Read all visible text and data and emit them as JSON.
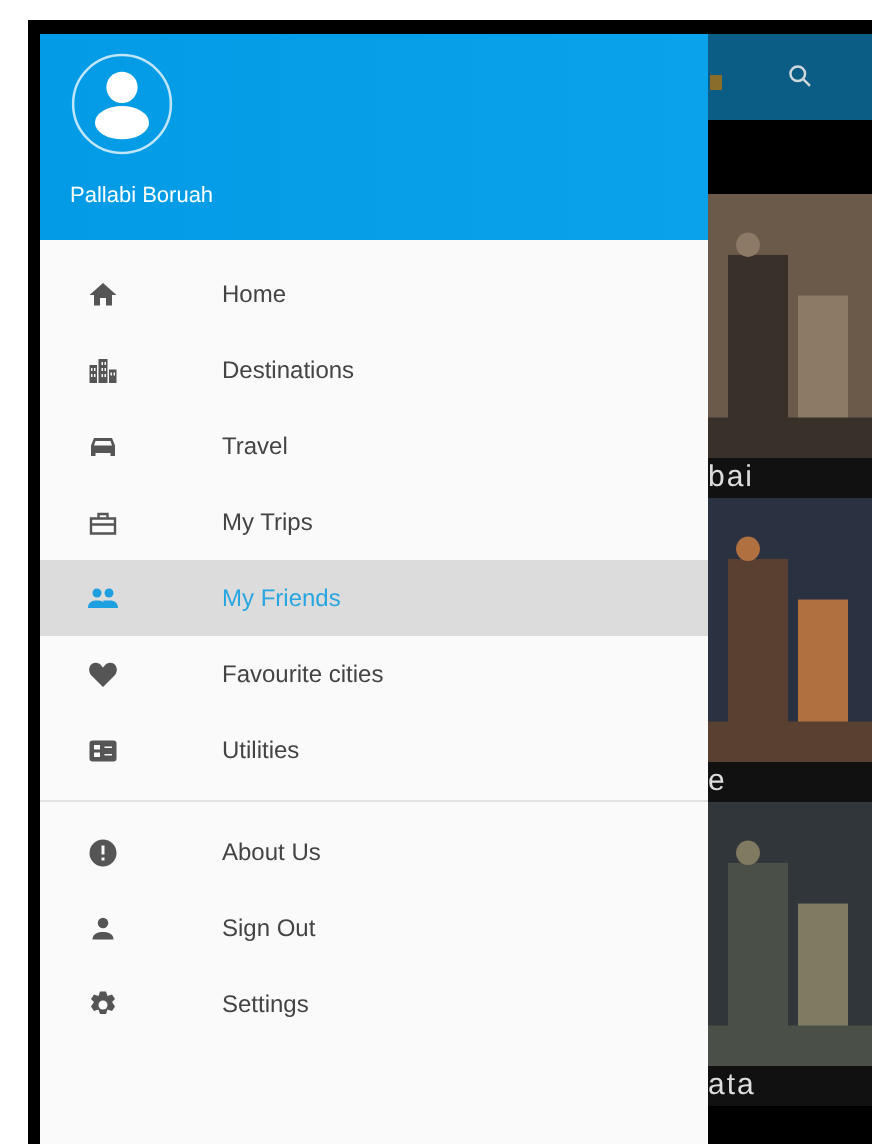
{
  "drawer": {
    "user_name": "Pallabi Boruah",
    "sections": [
      {
        "items": [
          {
            "label": "Home",
            "selected": false
          },
          {
            "label": "Destinations",
            "selected": false
          },
          {
            "label": "Travel",
            "selected": false
          },
          {
            "label": "My Trips",
            "selected": false
          },
          {
            "label": "My Friends",
            "selected": true
          },
          {
            "label": "Favourite cities",
            "selected": false
          },
          {
            "label": "Utilities",
            "selected": false
          }
        ]
      },
      {
        "items": [
          {
            "label": "About Us",
            "selected": false
          },
          {
            "label": "Sign Out",
            "selected": false
          },
          {
            "label": "Settings",
            "selected": false
          }
        ]
      }
    ]
  },
  "background": {
    "cards": [
      {
        "label": "bai",
        "kind": "picture"
      },
      {
        "label": "e",
        "kind": "picture"
      },
      {
        "label": "ata",
        "kind": "picture"
      }
    ]
  }
}
